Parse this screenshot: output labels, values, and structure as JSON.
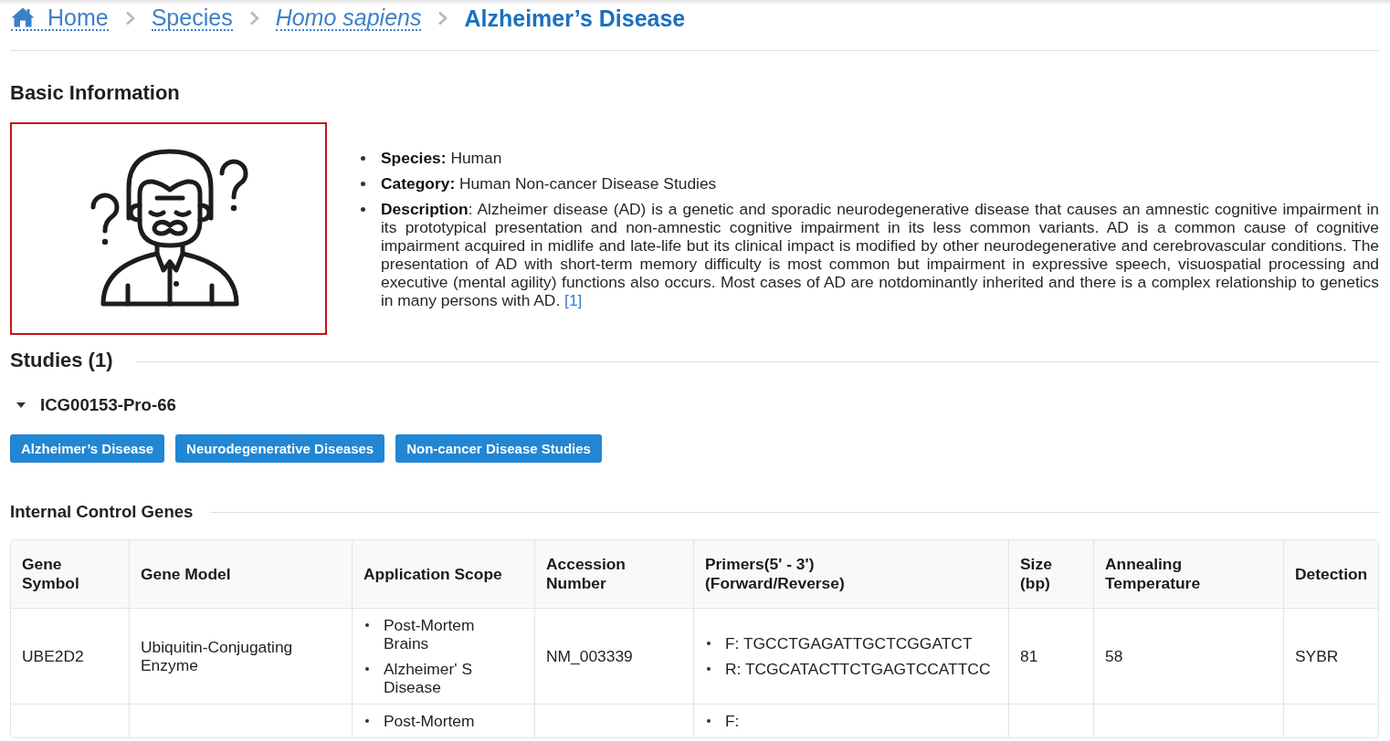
{
  "breadcrumb": [
    {
      "label": "Home",
      "kind": "home"
    },
    {
      "label": "Species",
      "kind": "link"
    },
    {
      "label": "Homo sapiens",
      "kind": "taxon"
    },
    {
      "label": "Alzheimer’s Disease",
      "kind": "current"
    }
  ],
  "basic_information": {
    "heading": "Basic Information",
    "details": [
      {
        "text": "**Species:** Human"
      },
      {
        "text": "**Category:** Human Non-cancer Disease Studies"
      },
      {
        "text": "**Description**: Alzheimer disease (AD) is a genetic and sporadic neurodegenerative disease that causes an amnestic cognitive impairment in its prototypical presentation and non-amnestic cognitive impairment in its less common variants. AD is a common cause of cognitive impairment acquired in midlife and late-life but its clinical impact is modified by other neurodegenerative and cerebrovascular conditions. The presentation of AD with short-term memory difficulty is most common but impairment in expressive speech, visuospatial processing and executive (mental agility) functions also occurs. Most cases of AD are notdominantly inherited and there is a complex relationship to genetics in many persons with AD.",
        "reference": "[1]"
      }
    ]
  },
  "studies": {
    "heading": "Studies (1)",
    "items": [
      {
        "title": "ICG00153-Pro-66",
        "expanded": true,
        "tags": [
          "Alzheimer’s Disease",
          "Neurodegenerative Diseases",
          "Non-cancer Disease Studies"
        ],
        "internal_control_genes": {
          "heading": "Internal Control Genes",
          "table": {
            "columns": [
              "Gene Symbol",
              "Gene Model",
              "Application Scope",
              "Accession Number",
              "Primers(5' - 3')\n(Forward/Reverse)",
              "Size (bp)",
              "Annealing Temperature",
              "Detection"
            ],
            "rows": [
              {
                "gene_symbol": "UBE2D2",
                "gene_model": "Ubiquitin-Conjugating Enzyme",
                "application_scope": [
                  "Post-Mortem Brains",
                  "Alzheimer' S Disease"
                ],
                "accession_number": "NM_003339",
                "primers": [
                  "F: TGCCTGAGATTGCTCGGATCT",
                  "R: TCGCATACTTCTGAGTCCATTCC"
                ],
                "size": "81",
                "annealing_temperature": "58",
                "detection": "SYBR"
              },
              {
                "application_scope": [
                  "Post-Mortem"
                ],
                "primers": [
                  "F:"
                ]
              }
            ]
          }
        }
      }
    ]
  }
}
